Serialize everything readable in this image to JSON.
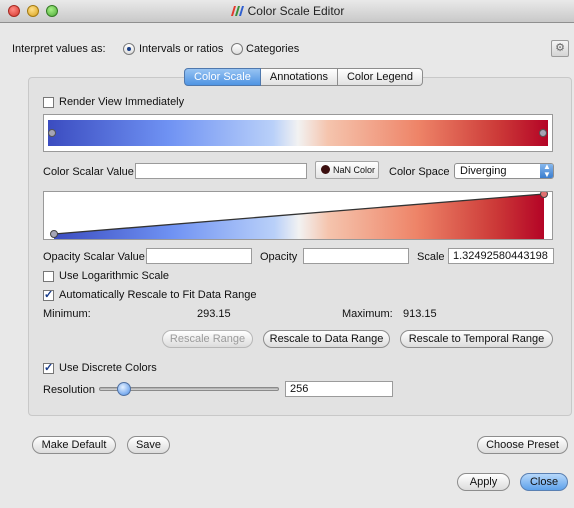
{
  "window": {
    "title": "Color Scale Editor"
  },
  "interpret": {
    "label": "Interpret values as:",
    "options": [
      {
        "label": "Intervals or ratios",
        "selected": true
      },
      {
        "label": "Categories",
        "selected": false
      }
    ]
  },
  "tabs": [
    {
      "label": "Color Scale",
      "active": true
    },
    {
      "label": "Annotations",
      "active": false
    },
    {
      "label": "Color Legend",
      "active": false
    }
  ],
  "render_view_immediately": {
    "label": "Render View Immediately",
    "checked": false
  },
  "color_scalar": {
    "label": "Color Scalar Value",
    "value": ""
  },
  "nan_color": {
    "label": "NaN Color",
    "color": "#3b0e0e"
  },
  "color_space": {
    "label": "Color Space",
    "value": "Diverging"
  },
  "opacity_scalar": {
    "label": "Opacity Scalar Value",
    "value": ""
  },
  "opacity": {
    "label": "Opacity",
    "value": ""
  },
  "scale": {
    "label": "Scale",
    "value": "1.32492580443198"
  },
  "use_log_scale": {
    "label": "Use Logarithmic Scale",
    "checked": false
  },
  "auto_rescale": {
    "label": "Automatically Rescale to Fit Data Range",
    "checked": true
  },
  "range": {
    "min_label": "Minimum:",
    "min_value": "293.15",
    "max_label": "Maximum:",
    "max_value": "913.15"
  },
  "rescale_buttons": {
    "rescale_range": "Rescale Range",
    "rescale_data": "Rescale to Data Range",
    "rescale_temporal": "Rescale to Temporal Range"
  },
  "discrete": {
    "label": "Use Discrete Colors",
    "checked": true
  },
  "resolution": {
    "label": "Resolution",
    "value": "256"
  },
  "footer": {
    "make_default": "Make Default",
    "save": "Save",
    "choose_preset": "Choose Preset",
    "apply": "Apply",
    "close": "Close"
  },
  "colors": {
    "cold": "#3b4cc0",
    "mid": "#f2f2f2",
    "hot": "#b40426",
    "tab_active": "#4f94e3",
    "close_button": "#5ea1ea"
  },
  "icons": [
    "app-icon",
    "gear-icon",
    "dropdown-arrow-icon"
  ]
}
